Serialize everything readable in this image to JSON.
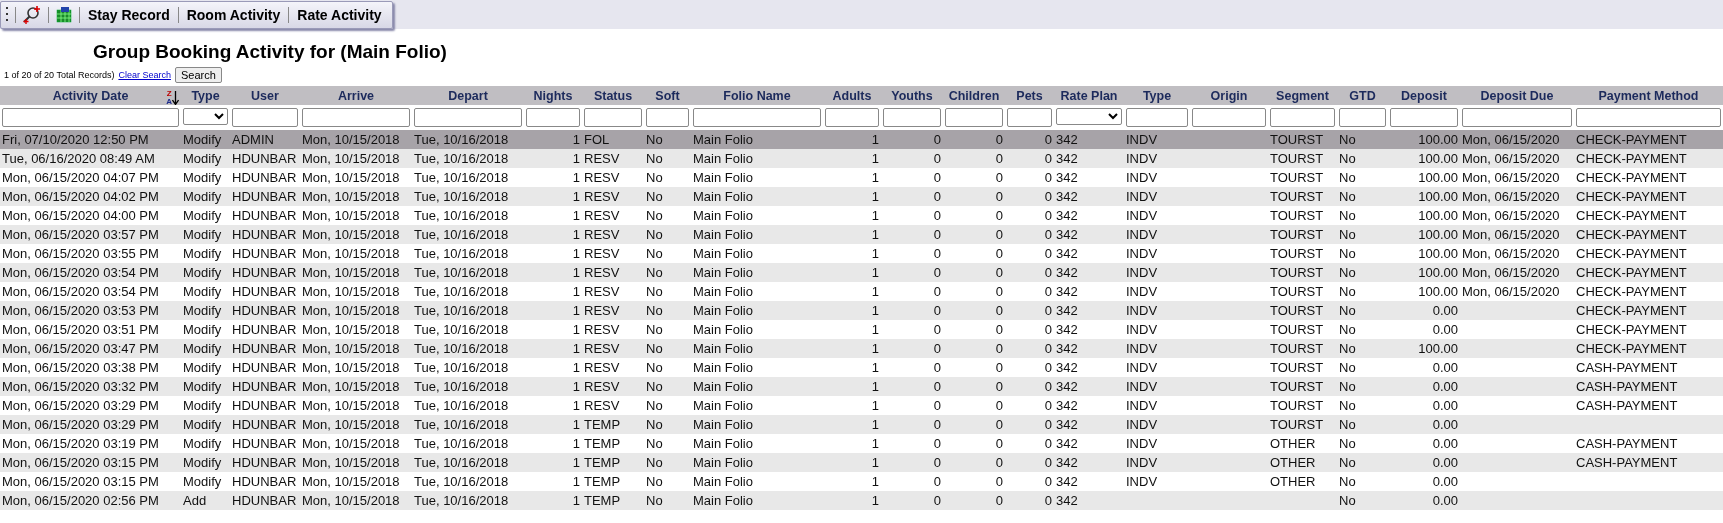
{
  "toolbar": {
    "buttons": [
      "Stay Record",
      "Room Activity",
      "Rate Activity"
    ]
  },
  "title": "Group Booking Activity for (Main Folio)",
  "records": {
    "summary": "1 of 20 of 20 Total Records)",
    "clear_link": "Clear Search",
    "search_button": "Search"
  },
  "table": {
    "sort_indicator": {
      "top": "Z",
      "bottom": "A"
    },
    "columns": [
      {
        "label": "Activity Date",
        "kind": "text"
      },
      {
        "label": "Type",
        "kind": "select"
      },
      {
        "label": "User",
        "kind": "text"
      },
      {
        "label": "Arrive",
        "kind": "text"
      },
      {
        "label": "Depart",
        "kind": "text"
      },
      {
        "label": "Nights",
        "kind": "text"
      },
      {
        "label": "Status",
        "kind": "text"
      },
      {
        "label": "Soft",
        "kind": "text"
      },
      {
        "label": "Folio Name",
        "kind": "text"
      },
      {
        "label": "Adults",
        "kind": "text"
      },
      {
        "label": "Youths",
        "kind": "text"
      },
      {
        "label": "Children",
        "kind": "text"
      },
      {
        "label": "Pets",
        "kind": "text"
      },
      {
        "label": "Rate Plan",
        "kind": "select"
      },
      {
        "label": "Type",
        "kind": "text"
      },
      {
        "label": "Origin",
        "kind": "text"
      },
      {
        "label": "Segment",
        "kind": "text"
      },
      {
        "label": "GTD",
        "kind": "text"
      },
      {
        "label": "Deposit",
        "kind": "text"
      },
      {
        "label": "Deposit Due",
        "kind": "text"
      },
      {
        "label": "Payment Method",
        "kind": "text"
      }
    ],
    "rows": [
      {
        "selected": true,
        "cells": [
          "Fri, 07/10/2020 12:50 PM",
          "Modify",
          "ADMIN",
          "Mon, 10/15/2018",
          "Tue, 10/16/2018",
          "1",
          "FOL",
          "No",
          "Main Folio",
          "1",
          "0",
          "0",
          "0",
          "342",
          "INDV",
          null,
          "TOURST",
          "No",
          "100.00",
          "Mon, 06/15/2020",
          "CHECK-PAYMENT"
        ]
      },
      {
        "selected": false,
        "cells": [
          "Tue, 06/16/2020 08:49 AM",
          "Modify",
          "HDUNBAR",
          "Mon, 10/15/2018",
          "Tue, 10/16/2018",
          "1",
          "RESV",
          "No",
          "Main Folio",
          "1",
          "0",
          "0",
          "0",
          "342",
          "INDV",
          null,
          "TOURST",
          "No",
          "100.00",
          "Mon, 06/15/2020",
          "CHECK-PAYMENT"
        ]
      },
      {
        "selected": false,
        "cells": [
          "Mon, 06/15/2020 04:07 PM",
          "Modify",
          "HDUNBAR",
          "Mon, 10/15/2018",
          "Tue, 10/16/2018",
          "1",
          "RESV",
          "No",
          "Main Folio",
          "1",
          "0",
          "0",
          "0",
          "342",
          "INDV",
          null,
          "TOURST",
          "No",
          "100.00",
          "Mon, 06/15/2020",
          "CHECK-PAYMENT"
        ]
      },
      {
        "selected": false,
        "cells": [
          "Mon, 06/15/2020 04:02 PM",
          "Modify",
          "HDUNBAR",
          "Mon, 10/15/2018",
          "Tue, 10/16/2018",
          "1",
          "RESV",
          "No",
          "Main Folio",
          "1",
          "0",
          "0",
          "0",
          "342",
          "INDV",
          null,
          "TOURST",
          "No",
          "100.00",
          "Mon, 06/15/2020",
          "CHECK-PAYMENT"
        ]
      },
      {
        "selected": false,
        "cells": [
          "Mon, 06/15/2020 04:00 PM",
          "Modify",
          "HDUNBAR",
          "Mon, 10/15/2018",
          "Tue, 10/16/2018",
          "1",
          "RESV",
          "No",
          "Main Folio",
          "1",
          "0",
          "0",
          "0",
          "342",
          "INDV",
          null,
          "TOURST",
          "No",
          "100.00",
          "Mon, 06/15/2020",
          "CHECK-PAYMENT"
        ]
      },
      {
        "selected": false,
        "cells": [
          "Mon, 06/15/2020 03:57 PM",
          "Modify",
          "HDUNBAR",
          "Mon, 10/15/2018",
          "Tue, 10/16/2018",
          "1",
          "RESV",
          "No",
          "Main Folio",
          "1",
          "0",
          "0",
          "0",
          "342",
          "INDV",
          null,
          "TOURST",
          "No",
          "100.00",
          "Mon, 06/15/2020",
          "CHECK-PAYMENT"
        ]
      },
      {
        "selected": false,
        "cells": [
          "Mon, 06/15/2020 03:55 PM",
          "Modify",
          "HDUNBAR",
          "Mon, 10/15/2018",
          "Tue, 10/16/2018",
          "1",
          "RESV",
          "No",
          "Main Folio",
          "1",
          "0",
          "0",
          "0",
          "342",
          "INDV",
          null,
          "TOURST",
          "No",
          "100.00",
          "Mon, 06/15/2020",
          "CHECK-PAYMENT"
        ]
      },
      {
        "selected": false,
        "cells": [
          "Mon, 06/15/2020 03:54 PM",
          "Modify",
          "HDUNBAR",
          "Mon, 10/15/2018",
          "Tue, 10/16/2018",
          "1",
          "RESV",
          "No",
          "Main Folio",
          "1",
          "0",
          "0",
          "0",
          "342",
          "INDV",
          null,
          "TOURST",
          "No",
          "100.00",
          "Mon, 06/15/2020",
          "CHECK-PAYMENT"
        ]
      },
      {
        "selected": false,
        "cells": [
          "Mon, 06/15/2020 03:54 PM",
          "Modify",
          "HDUNBAR",
          "Mon, 10/15/2018",
          "Tue, 10/16/2018",
          "1",
          "RESV",
          "No",
          "Main Folio",
          "1",
          "0",
          "0",
          "0",
          "342",
          "INDV",
          null,
          "TOURST",
          "No",
          "100.00",
          "Mon, 06/15/2020",
          "CHECK-PAYMENT"
        ]
      },
      {
        "selected": false,
        "cells": [
          "Mon, 06/15/2020 03:53 PM",
          "Modify",
          "HDUNBAR",
          "Mon, 10/15/2018",
          "Tue, 10/16/2018",
          "1",
          "RESV",
          "No",
          "Main Folio",
          "1",
          "0",
          "0",
          "0",
          "342",
          "INDV",
          null,
          "TOURST",
          "No",
          "0.00",
          null,
          "CHECK-PAYMENT"
        ]
      },
      {
        "selected": false,
        "cells": [
          "Mon, 06/15/2020 03:51 PM",
          "Modify",
          "HDUNBAR",
          "Mon, 10/15/2018",
          "Tue, 10/16/2018",
          "1",
          "RESV",
          "No",
          "Main Folio",
          "1",
          "0",
          "0",
          "0",
          "342",
          "INDV",
          null,
          "TOURST",
          "No",
          "0.00",
          null,
          "CHECK-PAYMENT"
        ]
      },
      {
        "selected": false,
        "cells": [
          "Mon, 06/15/2020 03:47 PM",
          "Modify",
          "HDUNBAR",
          "Mon, 10/15/2018",
          "Tue, 10/16/2018",
          "1",
          "RESV",
          "No",
          "Main Folio",
          "1",
          "0",
          "0",
          "0",
          "342",
          "INDV",
          null,
          "TOURST",
          "No",
          "100.00",
          null,
          "CHECK-PAYMENT"
        ]
      },
      {
        "selected": false,
        "cells": [
          "Mon, 06/15/2020 03:38 PM",
          "Modify",
          "HDUNBAR",
          "Mon, 10/15/2018",
          "Tue, 10/16/2018",
          "1",
          "RESV",
          "No",
          "Main Folio",
          "1",
          "0",
          "0",
          "0",
          "342",
          "INDV",
          null,
          "TOURST",
          "No",
          "0.00",
          null,
          "CASH-PAYMENT"
        ]
      },
      {
        "selected": false,
        "cells": [
          "Mon, 06/15/2020 03:32 PM",
          "Modify",
          "HDUNBAR",
          "Mon, 10/15/2018",
          "Tue, 10/16/2018",
          "1",
          "RESV",
          "No",
          "Main Folio",
          "1",
          "0",
          "0",
          "0",
          "342",
          "INDV",
          null,
          "TOURST",
          "No",
          "0.00",
          null,
          "CASH-PAYMENT"
        ]
      },
      {
        "selected": false,
        "cells": [
          "Mon, 06/15/2020 03:29 PM",
          "Modify",
          "HDUNBAR",
          "Mon, 10/15/2018",
          "Tue, 10/16/2018",
          "1",
          "RESV",
          "No",
          "Main Folio",
          "1",
          "0",
          "0",
          "0",
          "342",
          "INDV",
          null,
          "TOURST",
          "No",
          "0.00",
          null,
          "CASH-PAYMENT"
        ]
      },
      {
        "selected": false,
        "cells": [
          "Mon, 06/15/2020 03:29 PM",
          "Modify",
          "HDUNBAR",
          "Mon, 10/15/2018",
          "Tue, 10/16/2018",
          "1",
          "TEMP",
          "No",
          "Main Folio",
          "1",
          "0",
          "0",
          "0",
          "342",
          "INDV",
          null,
          "TOURST",
          "No",
          "0.00",
          null,
          null
        ]
      },
      {
        "selected": false,
        "cells": [
          "Mon, 06/15/2020 03:19 PM",
          "Modify",
          "HDUNBAR",
          "Mon, 10/15/2018",
          "Tue, 10/16/2018",
          "1",
          "TEMP",
          "No",
          "Main Folio",
          "1",
          "0",
          "0",
          "0",
          "342",
          "INDV",
          null,
          "OTHER",
          "No",
          "0.00",
          null,
          "CASH-PAYMENT"
        ]
      },
      {
        "selected": false,
        "cells": [
          "Mon, 06/15/2020 03:15 PM",
          "Modify",
          "HDUNBAR",
          "Mon, 10/15/2018",
          "Tue, 10/16/2018",
          "1",
          "TEMP",
          "No",
          "Main Folio",
          "1",
          "0",
          "0",
          "0",
          "342",
          "INDV",
          null,
          "OTHER",
          "No",
          "0.00",
          null,
          "CASH-PAYMENT"
        ]
      },
      {
        "selected": false,
        "cells": [
          "Mon, 06/15/2020 03:15 PM",
          "Modify",
          "HDUNBAR",
          "Mon, 10/15/2018",
          "Tue, 10/16/2018",
          "1",
          "TEMP",
          "No",
          "Main Folio",
          "1",
          "0",
          "0",
          "0",
          "342",
          "INDV",
          null,
          "OTHER",
          "No",
          "0.00",
          null,
          null
        ]
      },
      {
        "selected": false,
        "cells": [
          "Mon, 06/15/2020 02:56 PM",
          "Add",
          "HDUNBAR",
          "Mon, 10/15/2018",
          "Tue, 10/16/2018",
          "1",
          "TEMP",
          "No",
          "Main Folio",
          "1",
          "0",
          "0",
          "0",
          "342",
          null,
          null,
          null,
          "No",
          "0.00",
          null,
          null
        ]
      }
    ]
  }
}
